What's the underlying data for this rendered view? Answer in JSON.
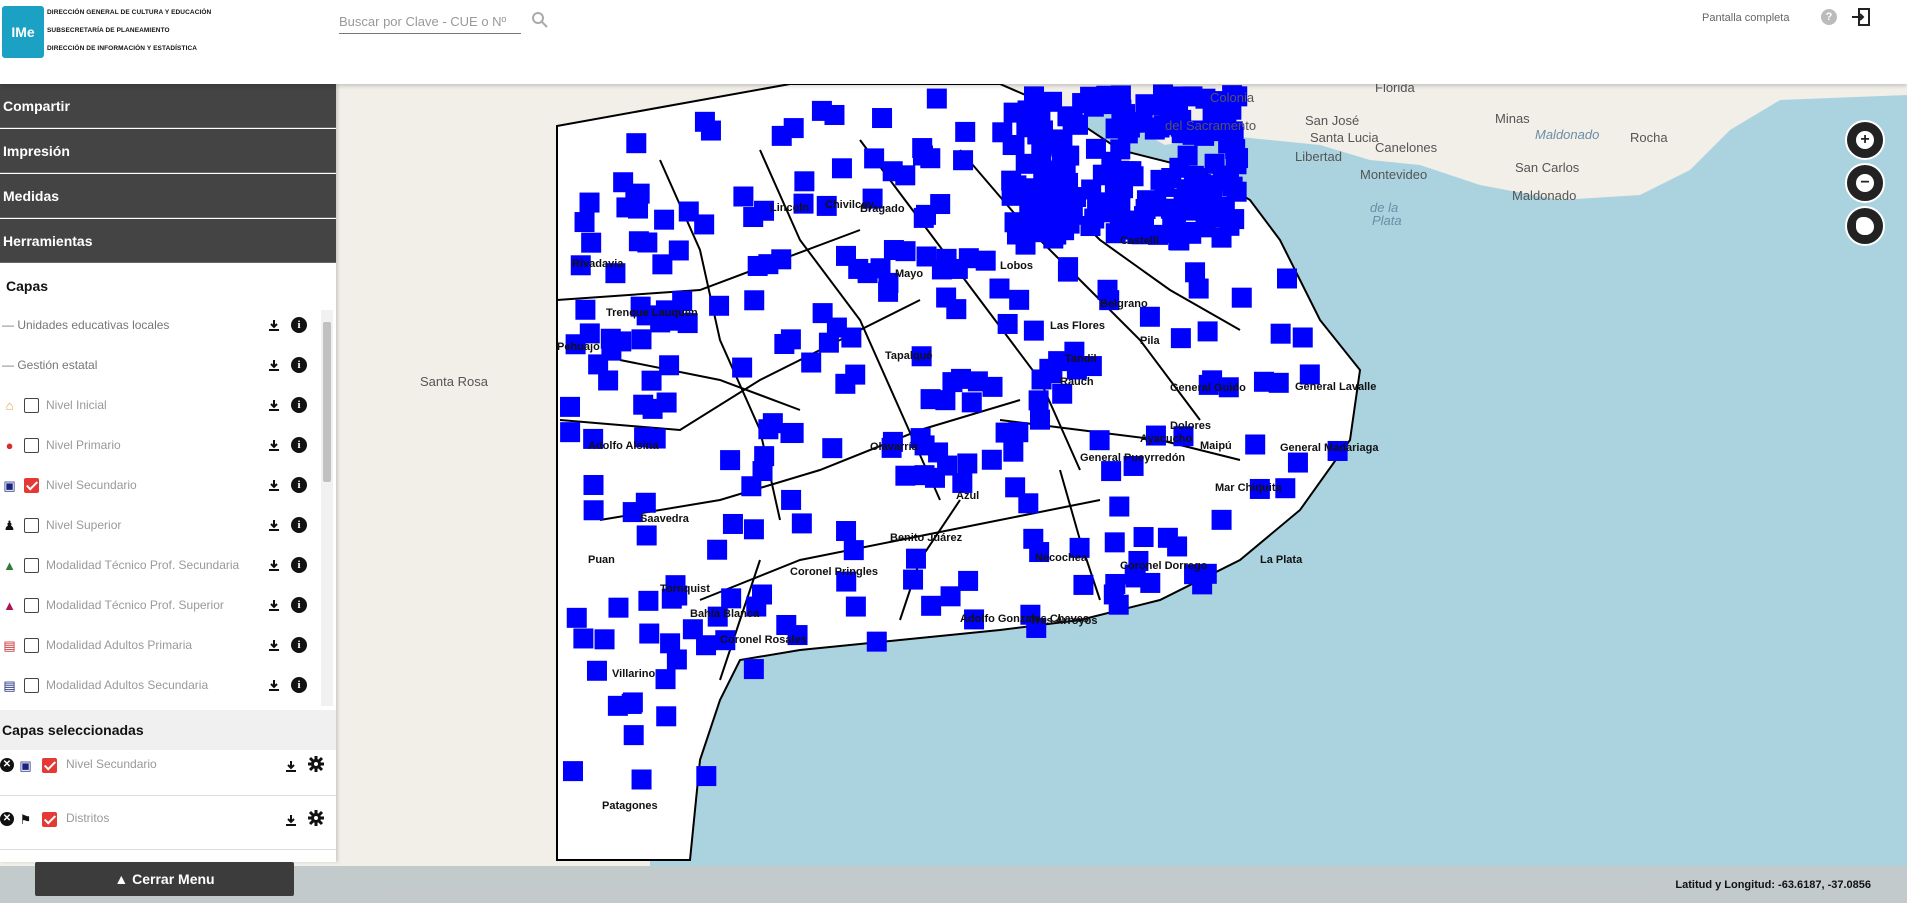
{
  "header": {
    "logo_text": "IMe",
    "org_lines": [
      "DIRECCIÓN GENERAL DE CULTURA Y EDUCACIÓN",
      "SUBSECRETARÍA DE PLANEAMIENTO",
      "DIRECCIÓN DE INFORMACIÓN Y ESTADÍSTICA"
    ],
    "search_placeholder": "Buscar por Clave - CUE o Nº",
    "fullscreen_label": "Pantalla completa",
    "help_label": "?"
  },
  "sidebar": {
    "menu": [
      "Compartir",
      "Impresión",
      "Medidas",
      "Herramientas"
    ],
    "capas_title": "Capas",
    "layers": [
      {
        "label": "Unidades educativas locales",
        "type": "group"
      },
      {
        "label": "Gestión estatal",
        "type": "group"
      },
      {
        "label": "Nivel Inicial",
        "checked": false,
        "icon": "house-icon",
        "color": "#e8a04a"
      },
      {
        "label": "Nivel Primario",
        "checked": false,
        "icon": "drop-icon",
        "color": "#d32f2f"
      },
      {
        "label": "Nivel Secundario",
        "checked": true,
        "icon": "school-icon",
        "color": "#1a237e"
      },
      {
        "label": "Nivel Superior",
        "checked": false,
        "icon": "person-icon",
        "color": "#111111"
      },
      {
        "label": "Modalidad Técnico Prof. Secundaria",
        "checked": false,
        "icon": "cap-icon",
        "color": "#2e7d32"
      },
      {
        "label": "Modalidad Técnico Prof. Superior",
        "checked": false,
        "icon": "cap-icon",
        "color": "#ad1457"
      },
      {
        "label": "Modalidad Adultos Primaria",
        "checked": false,
        "icon": "book-icon",
        "color": "#c62828"
      },
      {
        "label": "Modalidad Adultos Secundaria",
        "checked": false,
        "icon": "book-icon",
        "color": "#1a237e"
      }
    ],
    "selected_title": "Capas seleccionadas",
    "selected": [
      {
        "label": "Nivel Secundario",
        "checked": true,
        "icon": "school-icon"
      },
      {
        "label": "Distritos",
        "checked": true,
        "icon": "flag-icon"
      }
    ],
    "close_menu": "▲ Cerrar Menu"
  },
  "footer": {
    "coords": "Latitud y Longitud: -63.6187, -37.0856"
  },
  "map": {
    "labels": [
      "Colonia",
      "del Sacramento",
      "Florida",
      "San José",
      "Santa Lucia",
      "Libertad",
      "Canelones",
      "Minas",
      "Maldonado",
      "Rocha",
      "San Carlos",
      "Montevideo",
      "Maldonado",
      "de la",
      "Plata",
      "Santa Rosa",
      "Rivadavia",
      "Pehuajó",
      "Trenque Lauquen",
      "Adolfo Alsina",
      "Saavedra",
      "Puan",
      "Tornquist",
      "Bahía Blanca",
      "Coronel Rosales",
      "Villarino",
      "Patagones",
      "Coronel Pringles",
      "Olavarría",
      "Tapalqué",
      "Azul",
      "Benito Juárez",
      "Adolfo Gonzales Chaves",
      "Tres Arroyos",
      "Coronel Dorrego",
      "Tandil",
      "Necochea",
      "Pila",
      "Ayacucho",
      "Maipú",
      "Mar Chiquita",
      "General Pueyrredón",
      "La Plata",
      "General Lavalle",
      "General Madariaga",
      "Mayo",
      "Bragado",
      "Lincoln",
      "Castelli",
      "General Guido",
      "Dolores",
      "Chivilcoy",
      "Lobos",
      "Rauch",
      "Las Flores",
      "Belgrano"
    ],
    "colors": {
      "water": "#aad3df",
      "land": "#f2efe9",
      "province": "#ffffff",
      "border": "#000000",
      "marker": "#0000ff"
    }
  }
}
